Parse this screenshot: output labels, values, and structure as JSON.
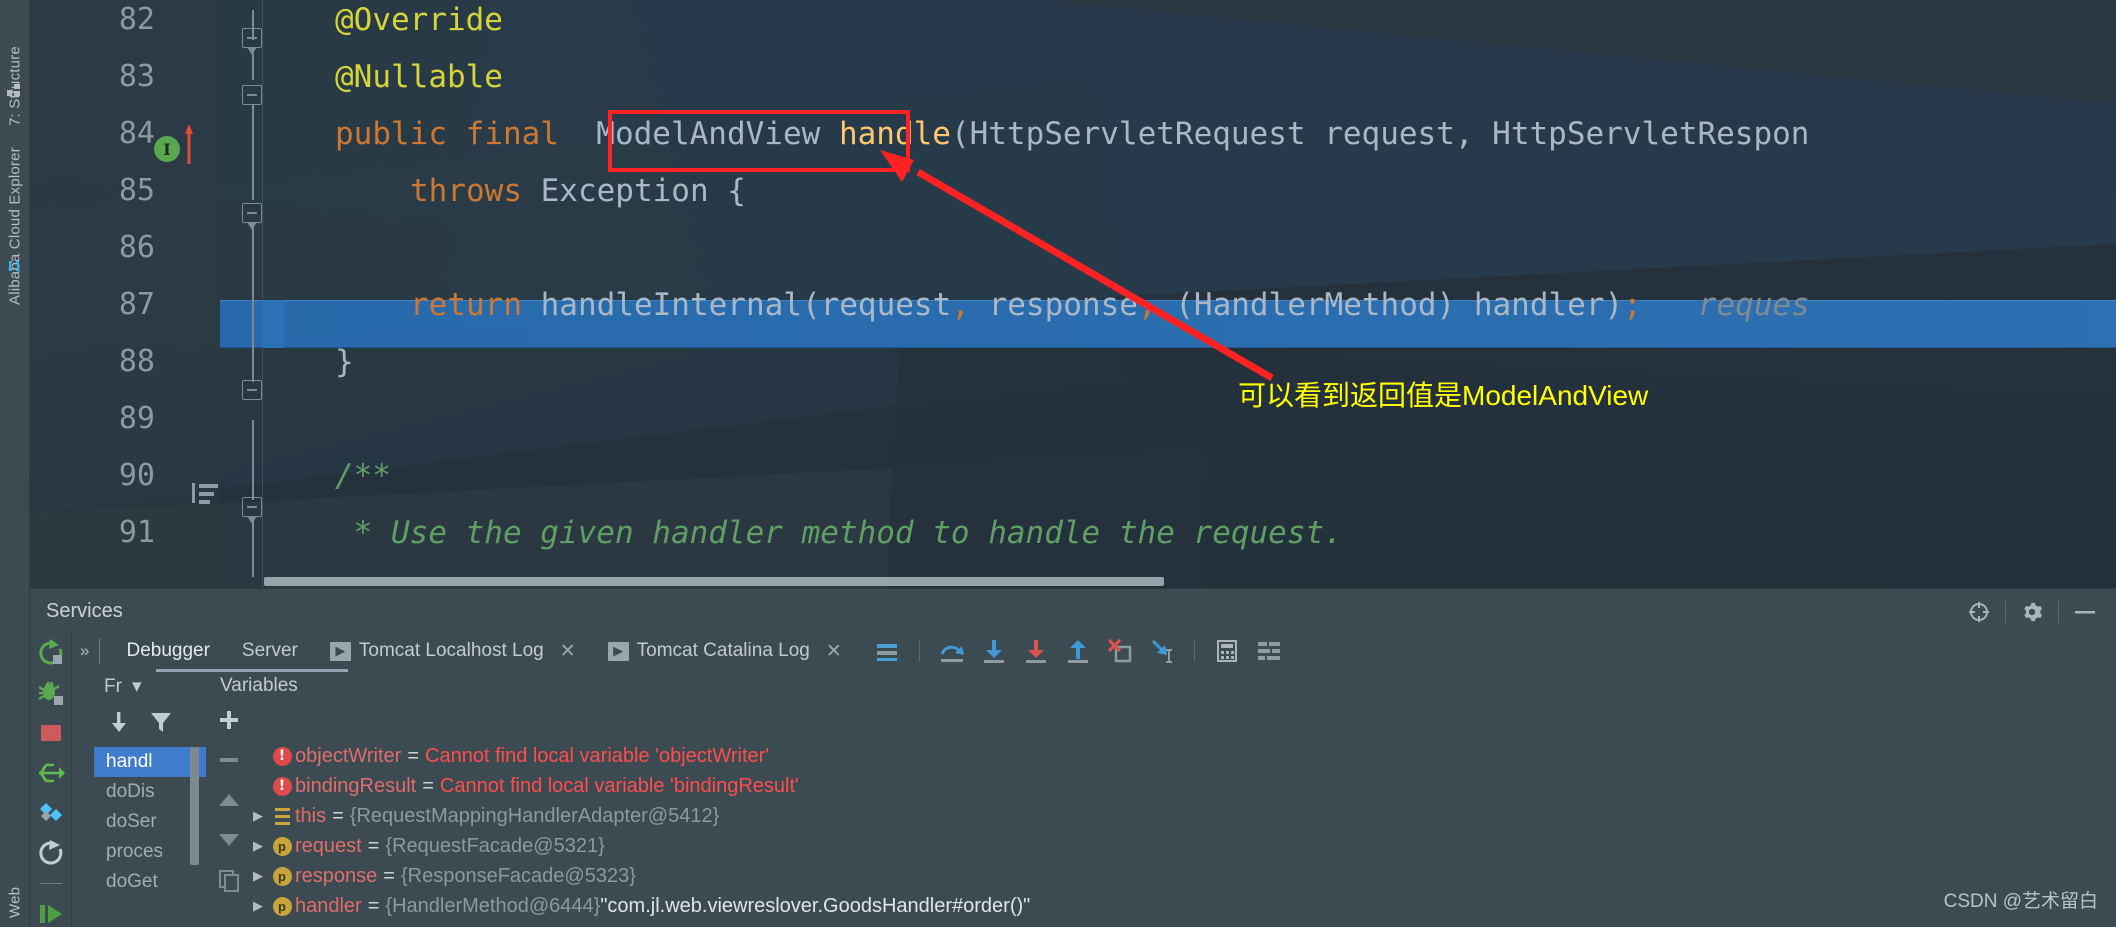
{
  "window": {
    "left_tool_tabs": [
      {
        "name": "structure",
        "label": "7: Structure",
        "icon": "structure-icon"
      },
      {
        "name": "alibaba",
        "label": "Alibaba Cloud Explorer",
        "icon": "cloud-icon"
      },
      {
        "name": "web",
        "label": "Web",
        "icon": ""
      }
    ]
  },
  "editor": {
    "lines": [
      {
        "num": "82",
        "indent": 1,
        "tokens": [
          {
            "t": "@Override",
            "c": "anno"
          }
        ]
      },
      {
        "num": "83",
        "indent": 1,
        "tokens": [
          {
            "t": "@Nullable",
            "c": "anno"
          }
        ]
      },
      {
        "num": "84",
        "indent": 1,
        "tokens": [
          {
            "t": "public",
            "c": "kw"
          },
          {
            "t": " ",
            "c": "punc"
          },
          {
            "t": "final",
            "c": "kw"
          },
          {
            "t": "  ModelAndView ",
            "c": "cls"
          },
          {
            "t": "handle",
            "c": "mth"
          },
          {
            "t": "(HttpServletRequest request, HttpServletRespon",
            "c": "cls"
          }
        ]
      },
      {
        "num": "85",
        "indent": 2,
        "tokens": [
          {
            "t": "throws",
            "c": "kw"
          },
          {
            "t": " Exception {",
            "c": "cls"
          }
        ]
      },
      {
        "num": "86",
        "indent": 0,
        "tokens": []
      },
      {
        "num": "87",
        "indent": 2,
        "tokens": [
          {
            "t": "return",
            "c": "kw"
          },
          {
            "t": " handleInternal(request",
            "c": "cls"
          },
          {
            "t": ",",
            "c": "semi"
          },
          {
            "t": " response",
            "c": "cls"
          },
          {
            "t": ",",
            "c": "semi"
          },
          {
            "t": " (HandlerMethod) handler)",
            "c": "cls"
          },
          {
            "t": ";",
            "c": "semi"
          }
        ],
        "hint": "reques"
      },
      {
        "num": "88",
        "indent": 1,
        "tokens": [
          {
            "t": "}",
            "c": "cls"
          }
        ]
      },
      {
        "num": "89",
        "indent": 0,
        "tokens": []
      },
      {
        "num": "90",
        "indent": 1,
        "tokens": [
          {
            "t": "/**",
            "c": "cmt"
          }
        ]
      },
      {
        "num": "91",
        "indent": 1,
        "tokens": [
          {
            "t": " * Use the given handler method to handle the request.",
            "c": "cmt"
          }
        ]
      }
    ],
    "gutter": {
      "implements_marker": "I",
      "override_arrow": "up-arrow"
    }
  },
  "annotation": {
    "note_text": "可以看到返回值是ModelAndView",
    "note_color": "#ffff00",
    "highlight_box_color": "#fe2222",
    "highlighted_symbol": "ModelAndView"
  },
  "services": {
    "title": "Services",
    "header_icons": [
      "target-icon",
      "gear-icon",
      "minimize-icon"
    ],
    "run_controls": [
      {
        "name": "rerun",
        "icon": "rerun-icon"
      },
      {
        "name": "debug",
        "icon": "debug-bug-icon"
      },
      {
        "name": "stop",
        "icon": "stop-square-icon"
      },
      {
        "name": "mute-breakpoints",
        "icon": "mute-breakpoints-icon"
      },
      {
        "name": "view-breakpoints",
        "icon": "breakpoints-diamond-icon"
      },
      {
        "name": "restart",
        "icon": "restart-circle-icon"
      },
      {
        "name": "resume",
        "icon": "resume-play-icon"
      }
    ],
    "tabs": [
      {
        "name": "debugger",
        "label": "Debugger",
        "active": true,
        "closable": false,
        "has_play_chip": false
      },
      {
        "name": "server",
        "label": "Server",
        "active": false,
        "closable": false,
        "has_play_chip": false
      },
      {
        "name": "tomcat-localhost-log",
        "label": "Tomcat Localhost Log",
        "active": false,
        "closable": true,
        "has_play_chip": true
      },
      {
        "name": "tomcat-catalina-log",
        "label": "Tomcat Catalina Log",
        "active": false,
        "closable": true,
        "has_play_chip": true
      }
    ],
    "debug_tools": [
      {
        "name": "show-execution-point",
        "icon": "execution-point-icon"
      },
      {
        "name": "step-over",
        "icon": "step-over-icon"
      },
      {
        "name": "step-into",
        "icon": "step-into-icon"
      },
      {
        "name": "force-step-into",
        "icon": "force-step-into-icon"
      },
      {
        "name": "step-out",
        "icon": "step-out-icon"
      },
      {
        "name": "drop-frame",
        "icon": "drop-frame-icon"
      },
      {
        "name": "run-to-cursor",
        "icon": "run-to-cursor-icon"
      },
      {
        "name": "evaluate-expression",
        "icon": "calculator-icon"
      },
      {
        "name": "layout-settings",
        "icon": "layout-icon"
      }
    ],
    "frames_label": "Fr",
    "variables_label": "Variables",
    "frames_tools": [
      {
        "name": "export-threads",
        "icon": "down-arrow-icon"
      },
      {
        "name": "filter-frames",
        "icon": "funnel-icon"
      }
    ],
    "variables_tools": [
      {
        "name": "add-watch",
        "icon": "plus-icon"
      },
      {
        "name": "remove-watch",
        "icon": "minus-icon"
      },
      {
        "name": "move-up",
        "icon": "up-triangle-icon"
      },
      {
        "name": "move-down",
        "icon": "down-triangle-icon"
      },
      {
        "name": "copy-value",
        "icon": "copy-icon"
      }
    ],
    "frames": [
      {
        "label": "handl",
        "selected": true
      },
      {
        "label": "doDis",
        "selected": false
      },
      {
        "label": "doSer",
        "selected": false
      },
      {
        "label": "proces",
        "selected": false
      },
      {
        "label": "doGet",
        "selected": false
      }
    ],
    "variables": [
      {
        "expandable": false,
        "icon": "error-badge",
        "name": "objectWriter",
        "eq": "=",
        "value": "Cannot find local variable 'objectWriter'",
        "value_kind": "error"
      },
      {
        "expandable": false,
        "icon": "error-badge",
        "name": "bindingResult",
        "eq": "=",
        "value": "Cannot find local variable 'bindingResult'",
        "value_kind": "error"
      },
      {
        "expandable": true,
        "icon": "object-badge",
        "name": "this",
        "eq": "=",
        "value": "{RequestMappingHandlerAdapter@5412}",
        "value_kind": "ref"
      },
      {
        "expandable": true,
        "icon": "param-badge",
        "name": "request",
        "eq": "=",
        "value": "{RequestFacade@5321}",
        "value_kind": "ref"
      },
      {
        "expandable": true,
        "icon": "param-badge",
        "name": "response",
        "eq": "=",
        "value": "{ResponseFacade@5323}",
        "value_kind": "ref"
      },
      {
        "expandable": true,
        "icon": "param-badge",
        "name": "handler",
        "eq": "=",
        "value": "{HandlerMethod@6444}",
        "value_kind": "ref",
        "extra": "\"com.jl.web.viewreslover.GoodsHandler#order()\""
      }
    ]
  },
  "watermark": "CSDN @艺术留白"
}
